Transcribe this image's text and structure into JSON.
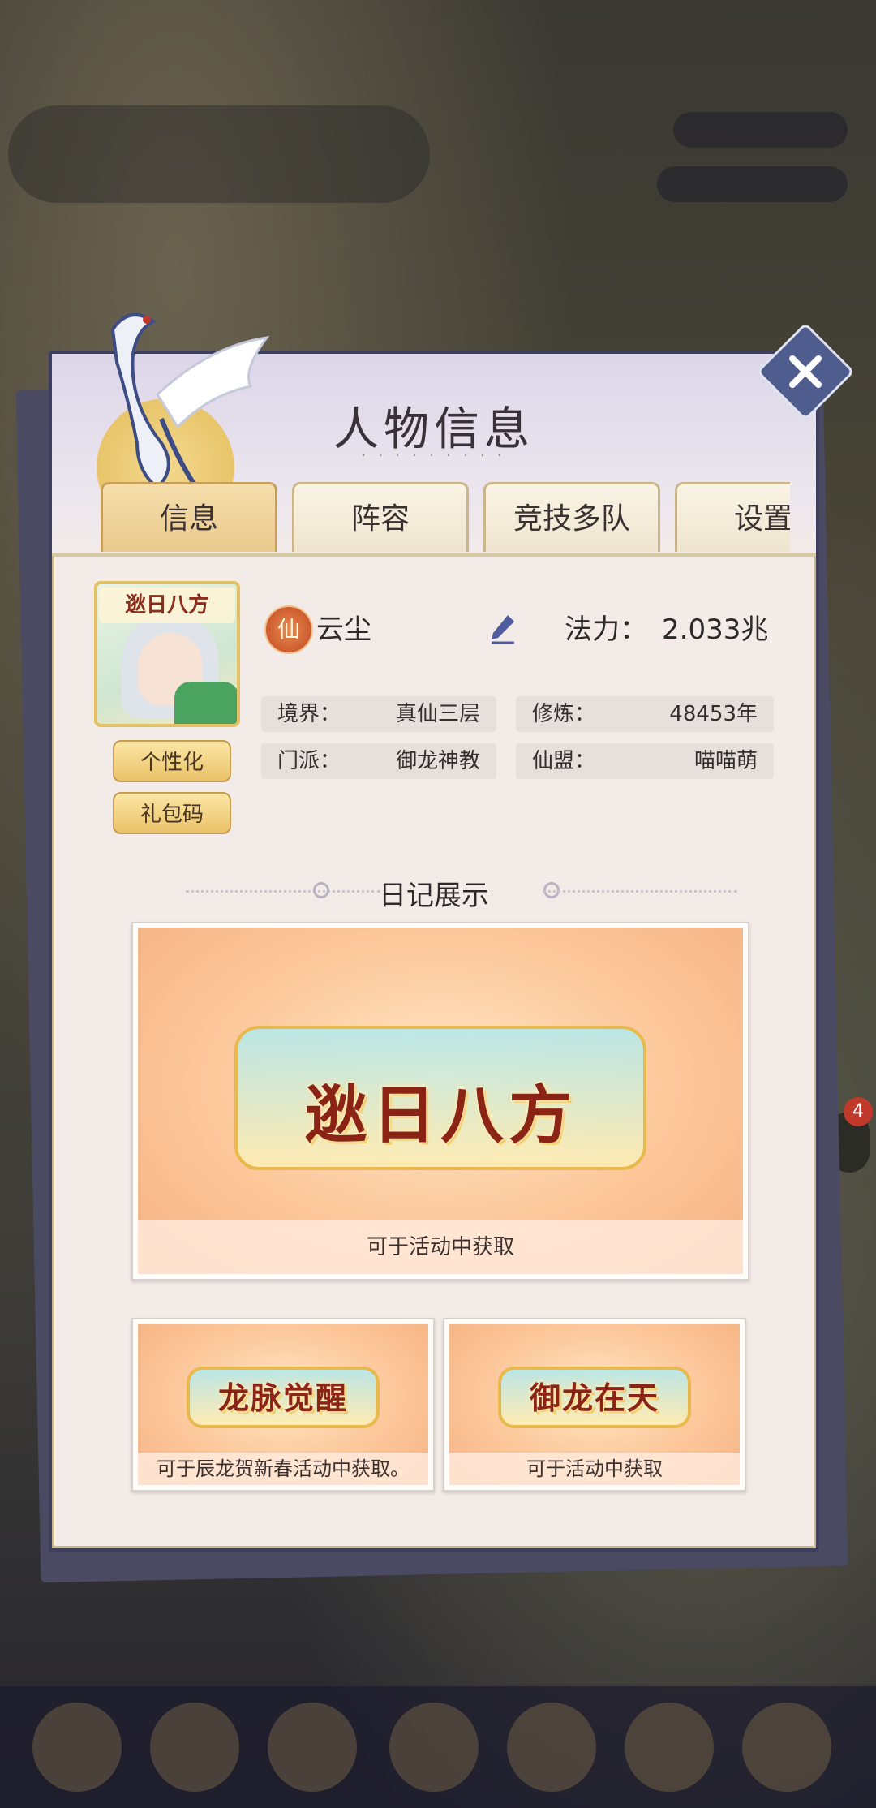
{
  "panel": {
    "title": "人物信息",
    "title_sub": "· · · · · · · · ·",
    "close_icon": "close-icon"
  },
  "tabs": [
    {
      "label": "信息",
      "active": true
    },
    {
      "label": "阵容",
      "active": false
    },
    {
      "label": "竞技多队",
      "active": false
    },
    {
      "label": "设置",
      "active": false
    }
  ],
  "profile": {
    "avatar_banner": "逖日八方",
    "element_badge": "仙",
    "name": "云尘",
    "power_label": "法力：",
    "power_value": "2.033兆",
    "stats": [
      {
        "key": "境界：",
        "value": "真仙三层"
      },
      {
        "key": "修炼：",
        "value": "48453年"
      },
      {
        "key": "门派：",
        "value": "御龙神教"
      },
      {
        "key": "仙盟：",
        "value": "喵喵萌"
      }
    ],
    "buttons": {
      "personalize": "个性化",
      "gift_code": "礼包码"
    }
  },
  "diary": {
    "section_title": "日记展示",
    "cards": [
      {
        "emblem": "逖日八方",
        "caption": "可于活动中获取"
      },
      {
        "emblem": "龙脉觉醒",
        "caption": "可于辰龙贺新春活动中获取。"
      },
      {
        "emblem": "御龙在天",
        "caption": "可于活动中获取"
      }
    ]
  },
  "background": {
    "side_badge": "4"
  },
  "colors": {
    "panel_bg": "#f3ebe8",
    "panel_border": "#3e3f5e",
    "tab_active": "#eac98c",
    "gold_button": "#eac26a",
    "card_art": "#fcc79a",
    "emblem_text": "#8c2416"
  }
}
